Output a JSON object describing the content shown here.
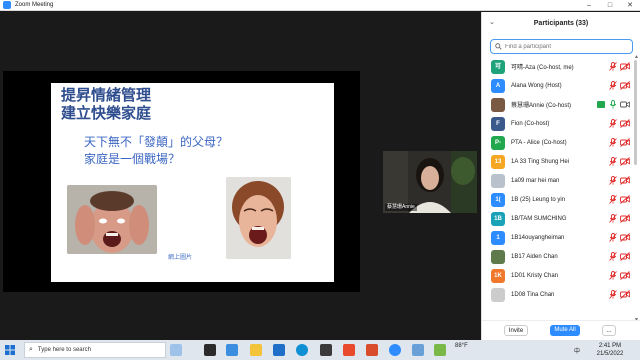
{
  "window": {
    "title": "Zoom Meeting",
    "controls": [
      "–",
      "□",
      "✕"
    ]
  },
  "slide": {
    "title_line1": "提昇情緒管理",
    "title_line2": "建立快樂家庭",
    "question1": "天下無不「發顛」的父母？",
    "question2": "家庭是一個戰場？",
    "caption": "網上圖片"
  },
  "webcam": {
    "label": "蔡慧珊Annie"
  },
  "participants": {
    "title": "Participants (33)",
    "search_placeholder": "Find a participant",
    "items": [
      {
        "avatar": "可",
        "avatar_color": "#1fa37a",
        "name": "可晴-Aza (Co-host, me)",
        "mic": "muted",
        "cam": "off"
      },
      {
        "avatar": "A",
        "avatar_color": "#2d8cff",
        "name": "Alana Wong (Host)",
        "mic": "muted",
        "cam": "off"
      },
      {
        "avatar": "",
        "avatar_color": "#7b5a44",
        "name": "蔡慧珊Annie (Co-host)",
        "mic": "on",
        "cam": "on",
        "sharing": true
      },
      {
        "avatar": "F",
        "avatar_color": "#3a5a8c",
        "name": "Fion (Co-host)",
        "mic": "muted",
        "cam": "off"
      },
      {
        "avatar": "P-",
        "avatar_color": "#21a84e",
        "name": "PTA - Alice (Co-host)",
        "mic": "muted",
        "cam": "off"
      },
      {
        "avatar": "13",
        "avatar_color": "#f5a623",
        "name": "1A 33 Ting Shung Hei",
        "mic": "muted",
        "cam": "off"
      },
      {
        "avatar": "",
        "avatar_color": "#b9c2cc",
        "name": "1a09 mar hei man",
        "mic": "muted",
        "cam": "off"
      },
      {
        "avatar": "1(",
        "avatar_color": "#2d8cff",
        "name": "1B (25) Leung to yin",
        "mic": "muted",
        "cam": "off"
      },
      {
        "avatar": "1B",
        "avatar_color": "#1aa3b8",
        "name": "1B/TAM SUMCHING",
        "mic": "muted",
        "cam": "off"
      },
      {
        "avatar": "1",
        "avatar_color": "#2d8cff",
        "name": "1B14ouyangheiman",
        "mic": "muted",
        "cam": "off"
      },
      {
        "avatar": "",
        "avatar_color": "#5f7a4a",
        "name": "1B17 Aiden Chan",
        "mic": "muted",
        "cam": "off"
      },
      {
        "avatar": "1K",
        "avatar_color": "#f0782a",
        "name": "1D01 Kristy Chan",
        "mic": "muted",
        "cam": "off"
      },
      {
        "avatar": "",
        "avatar_color": "#cccccc",
        "name": "1D08 Tina Chan",
        "mic": "muted",
        "cam": "off"
      }
    ],
    "invite_label": "Invite",
    "mute_all_label": "Mute All",
    "more_label": "..."
  },
  "taskbar": {
    "search_placeholder": "Type here to search",
    "weather": "88°F",
    "time": "2:41 PM",
    "date": "21/5/2022",
    "lang": "中"
  },
  "colors": {
    "zoom_blue": "#2d8cff",
    "muted_red": "#e02828"
  }
}
